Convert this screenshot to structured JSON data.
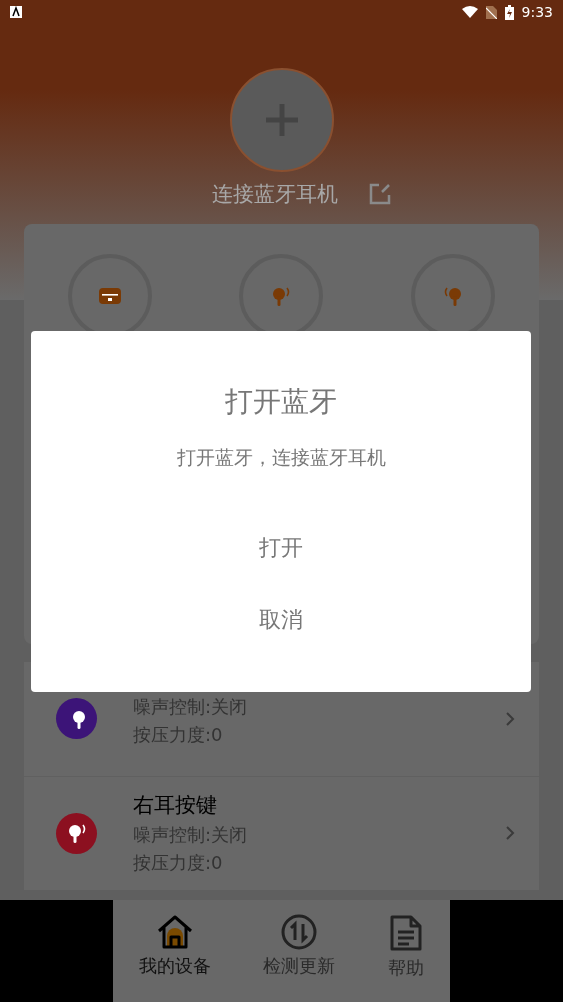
{
  "status_bar": {
    "time": "9:33"
  },
  "header": {
    "connect_label": "连接蓝牙耳机"
  },
  "device_icons": [
    {
      "kind": "case"
    },
    {
      "kind": "left"
    },
    {
      "kind": "right"
    }
  ],
  "key_settings": [
    {
      "kind": "left",
      "color": "#3c1478",
      "lines": [
        "噪声控制:关闭",
        "按压力度:0"
      ]
    },
    {
      "kind": "right",
      "color": "#8c1020",
      "title": "右耳按键",
      "lines": [
        "噪声控制:关闭",
        "按压力度:0"
      ]
    }
  ],
  "bottom_nav": [
    {
      "kind": "home",
      "label": "我的设备",
      "selected": true
    },
    {
      "kind": "update",
      "label": "检测更新",
      "selected": false
    },
    {
      "kind": "doc",
      "label": "帮助",
      "selected": false
    }
  ],
  "dialog": {
    "title": "打开蓝牙",
    "message": "打开蓝牙，连接蓝牙耳机",
    "buttons": [
      "打开",
      "取消"
    ]
  }
}
